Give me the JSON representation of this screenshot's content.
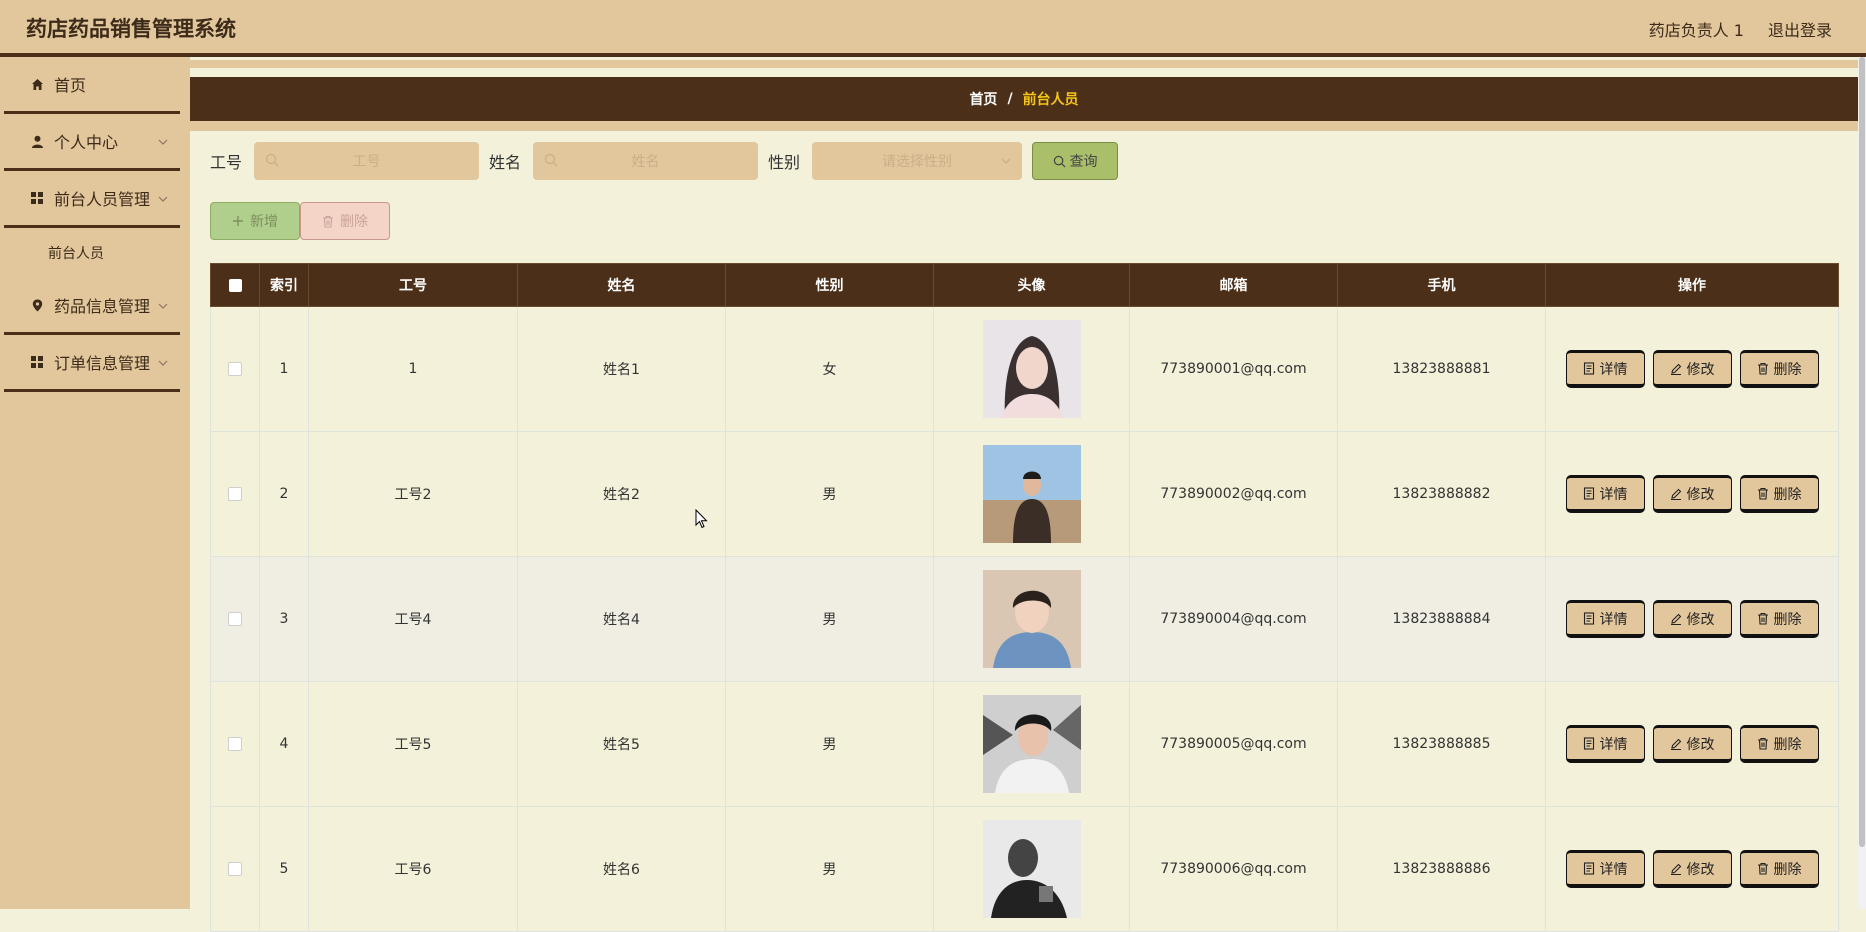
{
  "header": {
    "title": "药店药品销售管理系统",
    "user": "药店负责人 1",
    "logout": "退出登录"
  },
  "sidebar": {
    "items": [
      {
        "label": "首页",
        "icon": "home-icon"
      },
      {
        "label": "个人中心",
        "icon": "user-icon"
      },
      {
        "label": "前台人员管理",
        "icon": "grid-icon"
      },
      {
        "label": "药品信息管理",
        "icon": "location-pin-icon"
      },
      {
        "label": "订单信息管理",
        "icon": "grid-icon"
      }
    ],
    "subitem": "前台人员"
  },
  "breadcrumb": {
    "home": "首页",
    "sep": "/",
    "current": "前台人员"
  },
  "search": {
    "id_label": "工号",
    "id_placeholder": "工号",
    "name_label": "姓名",
    "name_placeholder": "姓名",
    "gender_label": "性别",
    "gender_placeholder": "请选择性别",
    "query_label": "查询"
  },
  "toolbar": {
    "add_label": "新增",
    "delete_label": "删除"
  },
  "table": {
    "columns": [
      "索引",
      "工号",
      "姓名",
      "性别",
      "头像",
      "邮箱",
      "手机",
      "操作"
    ],
    "rows": [
      {
        "index": "1",
        "id": "1",
        "name": "姓名1",
        "gender": "女",
        "email": "773890001@qq.com",
        "phone": "13823888881"
      },
      {
        "index": "2",
        "id": "工号2",
        "name": "姓名2",
        "gender": "男",
        "email": "773890002@qq.com",
        "phone": "13823888882"
      },
      {
        "index": "3",
        "id": "工号4",
        "name": "姓名4",
        "gender": "男",
        "email": "773890004@qq.com",
        "phone": "13823888884"
      },
      {
        "index": "4",
        "id": "工号5",
        "name": "姓名5",
        "gender": "男",
        "email": "773890005@qq.com",
        "phone": "13823888885"
      },
      {
        "index": "5",
        "id": "工号6",
        "name": "姓名6",
        "gender": "男",
        "email": "773890006@qq.com",
        "phone": "13823888886"
      }
    ],
    "actions": {
      "detail": "详情",
      "edit": "修改",
      "delete": "删除"
    }
  },
  "colors": {
    "topbar": "#e2c69c",
    "dark_brown": "#4c2f18",
    "content_bg": "#f3f1da",
    "query_button": "#a9bf6a",
    "add_button": "#b0cf8c",
    "delete_button": "#f5d4c8",
    "breadcrumb_current": "#f5c518"
  }
}
